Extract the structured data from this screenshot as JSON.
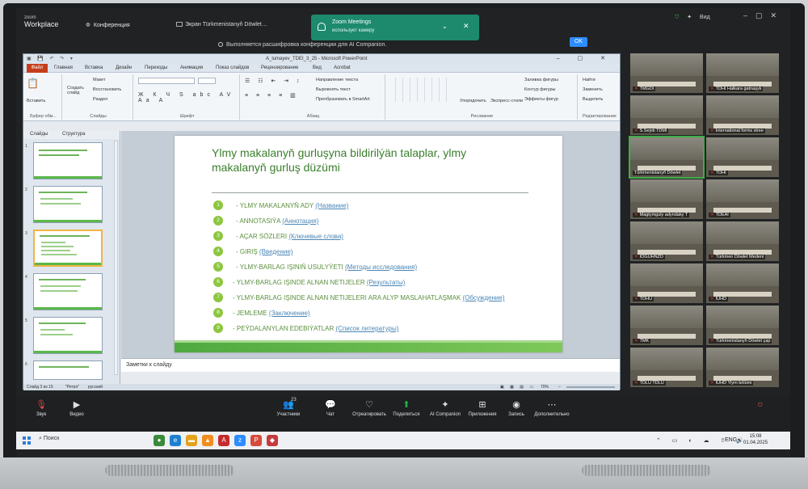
{
  "zoom_top": {
    "brand_small": "zoom",
    "brand_big": "Workplace",
    "conference": "Конференция",
    "screen_share": "Экран Türkmenistanyň Döwlet…",
    "recording": "Выполняется расшифровка конференции для AI Companion.",
    "notification_title": "Zoom Meetings",
    "notification_text": "использует камеру",
    "ok": "OK",
    "view": "Вид"
  },
  "ppt": {
    "window_title": "A_lumayev_TDEI_3_25 - Microsoft PowerPoint",
    "tabs": [
      "Файл",
      "Главная",
      "Вставка",
      "Дизайн",
      "Переходы",
      "Анимация",
      "Показ слайдов",
      "Рецензирование",
      "Вид",
      "Acrobat"
    ],
    "ribbon": {
      "paste": "Вставить",
      "clipboard": "Буфер обм...",
      "new_slide": "Создать слайд",
      "layout": "Макет",
      "reset": "Восстановить",
      "section": "Раздел",
      "slides_group": "Слайды",
      "font_group": "Шрифт",
      "paragraph_group": "Абзац",
      "text_direction": "Направление текста",
      "align_text": "Выровнять текст",
      "smartart": "Преобразовать в SmartArt",
      "arrange": "Упорядочить",
      "express_styles": "Экспресс-стили",
      "drawing_group": "Рисование",
      "fill": "Заливка фигуры",
      "outline": "Контур фигуры",
      "effects": "Эффекты фигур",
      "find": "Найти",
      "replace": "Заменить",
      "select": "Выделить",
      "editing_group": "Редактирование"
    },
    "pane_tabs": [
      "Слайды",
      "Структура"
    ],
    "slide_numbers": [
      "1",
      "2",
      "3",
      "4",
      "5",
      "6"
    ],
    "slide": {
      "title": "Ylmy makalanyň gurluşyna bildirilýän talaplar, ylmy makalanyň gurluş düzümi",
      "items": [
        {
          "n": "1",
          "tk": "- YLMY MAKALANYŇ ADY",
          "ru": "(Название)"
        },
        {
          "n": "2",
          "tk": "- ANNOTASIÝA",
          "ru": "(Аннотация)"
        },
        {
          "n": "3",
          "tk": "- AÇAR SÖZLERI",
          "ru": "(Ключевые слова)"
        },
        {
          "n": "4",
          "tk": "- GIRIŞ",
          "ru": "(Введение)"
        },
        {
          "n": "5",
          "tk": "- YLMY-BARLAG IŞINIŇ USULYÝETI",
          "ru": "(Методы исследования)"
        },
        {
          "n": "6",
          "tk": "- YLMY-BARLAG IŞINDE ALNAN NETIJELER",
          "ru": "(Результаты)"
        },
        {
          "n": "7",
          "tk": "- YLMY-BARLAG IŞINDE ALNAN NETIJELERI ARA ALYP MASLAHATLAŞMAK",
          "ru": "(Обсуждение)"
        },
        {
          "n": "8",
          "tk": "- JEMLEME",
          "ru": "(Заключение)"
        },
        {
          "n": "9",
          "tk": "- PEÝDALANYLAN EDEBIÝATLAR",
          "ru": "(Список литературы)"
        }
      ]
    },
    "notes_placeholder": "Заметки к слайду",
    "status": {
      "slide": "Слайд 3 из 15",
      "theme": "\"Ретро\"",
      "language": "русский",
      "zoom": "70%"
    }
  },
  "gallery": [
    {
      "label": "TMGDI",
      "active": false
    },
    {
      "label": "TDHI Halkara gatnaşyk",
      "active": false
    },
    {
      "label": "S.Seýdi TDMI",
      "active": false
    },
    {
      "label": "International forms stree",
      "active": false
    },
    {
      "label": "Türkmenistanyň Döwlet",
      "active": true
    },
    {
      "label": "TOHI",
      "active": false
    },
    {
      "label": "Magtymguly adyndaky T",
      "active": false
    },
    {
      "label": "TDEAI",
      "active": false
    },
    {
      "label": "IOGUHNZD",
      "active": false
    },
    {
      "label": "Türkmen Döwlet Medeni",
      "active": false
    },
    {
      "label": "TOHU",
      "active": false
    },
    {
      "label": "IUHD",
      "active": false
    },
    {
      "label": "TMK",
      "active": false
    },
    {
      "label": "Türkmenistanyň Döwlet çap",
      "active": false
    },
    {
      "label": "TDLU TDLU",
      "active": false
    },
    {
      "label": "IUHD Ylym bölümi",
      "active": false
    }
  ],
  "zoom_bar": {
    "audio": "Звук",
    "video": "Видео",
    "participants": "Участники",
    "participants_count": "23",
    "chat": "Чат",
    "react": "Отреагировать",
    "share": "Поделиться",
    "companion": "AI Companion",
    "apps": "Приложения",
    "record": "Запись",
    "more": "Дополнительно"
  },
  "taskbar": {
    "search": "Поиск",
    "lang": "ENG",
    "time": "15:08",
    "date": "01.04.2025"
  }
}
